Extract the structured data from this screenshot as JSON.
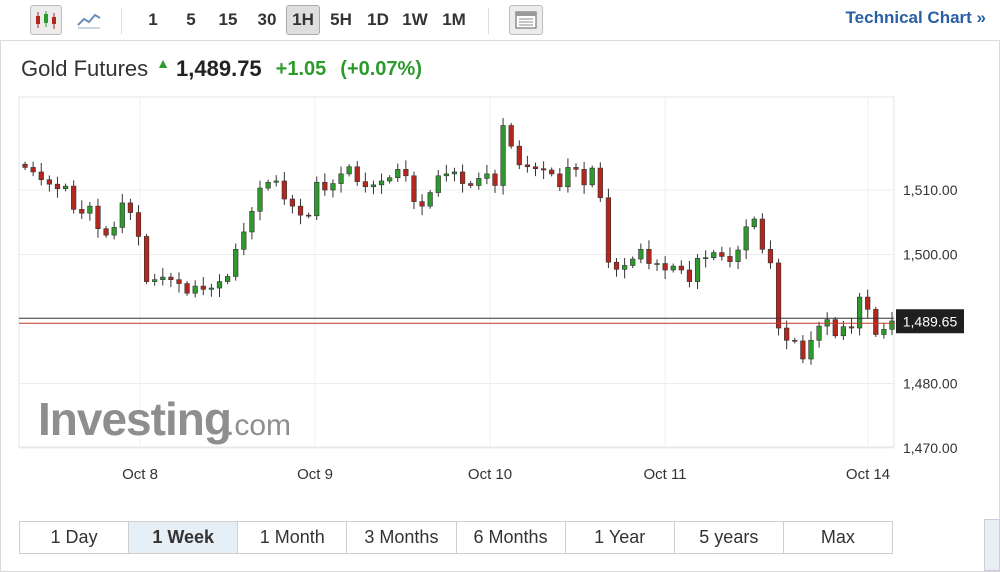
{
  "toolbar": {
    "chart_icons": [
      "candlestick-icon",
      "line-chart-icon"
    ],
    "intervals": [
      "1",
      "5",
      "15",
      "30",
      "1H",
      "5H",
      "1D",
      "1W",
      "1M"
    ],
    "selected_interval": "1H",
    "technical_chart_label": "Technical Chart »"
  },
  "quote": {
    "name": "Gold Futures",
    "price": "1,489.75",
    "change": "+1.05",
    "change_pct": "(+0.07%)"
  },
  "colors": {
    "up": "#2e9a2e",
    "down": "#b5261e",
    "accent": "#2a5fa5"
  },
  "watermark": {
    "brand": "Investing",
    "suffix": ".com"
  },
  "ranges": [
    "1 Day",
    "1 Week",
    "1 Month",
    "3 Months",
    "6 Months",
    "1 Year",
    "5 years",
    "Max"
  ],
  "selected_range": "1 Week",
  "chart_data": {
    "type": "candlestick",
    "x_labels": [
      "Oct 8",
      "Oct 9",
      "Oct 10",
      "Oct 11",
      "Oct 14"
    ],
    "y_ticks": [
      1510,
      1500,
      1480,
      1470
    ],
    "y_tick_labels": [
      "1,510.00",
      "1,500.00",
      "1,480.00",
      "1,470.00"
    ],
    "ylim": [
      1470,
      1518
    ],
    "current_price_label": "1,489.65",
    "current_price": 1489.65,
    "closes": [
      1513.5,
      1512.8,
      1511.6,
      1510.9,
      1510.2,
      1510.6,
      1507.0,
      1506.4,
      1507.5,
      1504.0,
      1503.0,
      1504.2,
      1508.0,
      1506.5,
      1502.8,
      1495.8,
      1496.1,
      1496.5,
      1496.1,
      1495.5,
      1494.0,
      1495.1,
      1494.6,
      1494.8,
      1495.8,
      1496.6,
      1500.8,
      1503.5,
      1506.7,
      1510.3,
      1511.2,
      1511.4,
      1508.6,
      1507.5,
      1506.1,
      1506.0,
      1511.2,
      1510.0,
      1511.0,
      1512.5,
      1513.6,
      1511.3,
      1510.5,
      1510.8,
      1511.4,
      1511.9,
      1513.2,
      1512.2,
      1508.2,
      1507.5,
      1509.6,
      1512.2,
      1512.5,
      1512.8,
      1511.0,
      1510.7,
      1511.8,
      1512.5,
      1510.7,
      1520.0,
      1516.8,
      1513.9,
      1513.6,
      1513.3,
      1513.1,
      1512.5,
      1510.5,
      1513.5,
      1513.2,
      1510.8,
      1513.4,
      1508.8,
      1498.8,
      1497.7,
      1498.3,
      1499.3,
      1500.8,
      1498.6,
      1498.6,
      1497.6,
      1498.2,
      1497.6,
      1495.8,
      1499.4,
      1499.5,
      1500.3,
      1499.7,
      1498.9,
      1500.7,
      1504.3,
      1505.5,
      1500.8,
      1498.7,
      1488.6,
      1486.7,
      1486.6,
      1483.8,
      1486.7,
      1488.9,
      1489.9,
      1487.4,
      1488.8,
      1488.6,
      1493.4,
      1491.5,
      1487.6,
      1488.4,
      1489.7
    ],
    "series": [
      {
        "name": "Gold Futures"
      }
    ]
  }
}
